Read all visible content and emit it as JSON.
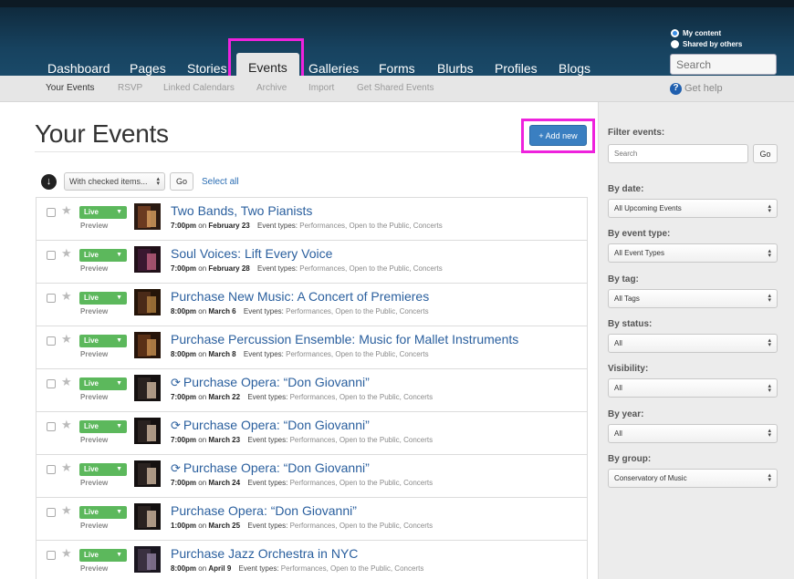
{
  "nav": {
    "items": [
      {
        "label": "Dashboard"
      },
      {
        "label": "Pages"
      },
      {
        "label": "Stories"
      },
      {
        "label": "Events"
      },
      {
        "label": "Galleries"
      },
      {
        "label": "Forms"
      },
      {
        "label": "Blurbs"
      },
      {
        "label": "Profiles"
      },
      {
        "label": "Blogs"
      }
    ],
    "active": "Events"
  },
  "visibility": {
    "my_content": "My content",
    "shared": "Shared by others"
  },
  "search": {
    "placeholder": "Search"
  },
  "subnav": {
    "items": [
      {
        "label": "Your Events"
      },
      {
        "label": "RSVP"
      },
      {
        "label": "Linked Calendars"
      },
      {
        "label": "Archive"
      },
      {
        "label": "Import"
      },
      {
        "label": "Get Shared Events"
      }
    ],
    "help": "Get help"
  },
  "main": {
    "title": "Your Events",
    "add_new": "+ Add new",
    "bulk_action": "With checked items...",
    "go": "Go",
    "select_all": "Select all"
  },
  "events": [
    {
      "status": "Live",
      "preview": "Preview",
      "title": "Two Bands, Two Pianists",
      "time": "7:00pm",
      "date": "February 23",
      "recurring": false,
      "types_label": "Event types:",
      "types": "Performances, Open to the Public, Concerts"
    },
    {
      "status": "Live",
      "preview": "Preview",
      "title": "Soul Voices: Lift Every Voice",
      "time": "7:00pm",
      "date": "February 28",
      "recurring": false,
      "types_label": "Event types:",
      "types": "Performances, Open to the Public, Concerts"
    },
    {
      "status": "Live",
      "preview": "Preview",
      "title": "Purchase New Music: A Concert of Premieres",
      "time": "8:00pm",
      "date": "March 6",
      "recurring": false,
      "types_label": "Event types:",
      "types": "Performances, Open to the Public, Concerts"
    },
    {
      "status": "Live",
      "preview": "Preview",
      "title": "Purchase Percussion Ensemble: Music for Mallet Instruments",
      "time": "8:00pm",
      "date": "March 8",
      "recurring": false,
      "types_label": "Event types:",
      "types": "Performances, Open to the Public, Concerts"
    },
    {
      "status": "Live",
      "preview": "Preview",
      "title": "Purchase Opera: “Don Giovanni”",
      "time": "7:00pm",
      "date": "March 22",
      "recurring": true,
      "types_label": "Event types:",
      "types": "Performances, Open to the Public, Concerts"
    },
    {
      "status": "Live",
      "preview": "Preview",
      "title": "Purchase Opera: “Don Giovanni”",
      "time": "7:00pm",
      "date": "March 23",
      "recurring": true,
      "types_label": "Event types:",
      "types": "Performances, Open to the Public, Concerts"
    },
    {
      "status": "Live",
      "preview": "Preview",
      "title": "Purchase Opera: “Don Giovanni”",
      "time": "7:00pm",
      "date": "March 24",
      "recurring": true,
      "types_label": "Event types:",
      "types": "Performances, Open to the Public, Concerts"
    },
    {
      "status": "Live",
      "preview": "Preview",
      "title": "Purchase Opera: “Don Giovanni”",
      "time": "1:00pm",
      "date": "March 25",
      "recurring": false,
      "types_label": "Event types:",
      "types": "Performances, Open to the Public, Concerts"
    },
    {
      "status": "Live",
      "preview": "Preview",
      "title": "Purchase Jazz Orchestra in NYC",
      "time": "8:00pm",
      "date": "April 9",
      "recurring": false,
      "types_label": "Event types:",
      "types": "Performances, Open to the Public, Concerts"
    }
  ],
  "on_word": "on",
  "sidebar": {
    "filter_label": "Filter events:",
    "filter_placeholder": "Search",
    "go": "Go",
    "filters": [
      {
        "label": "By date:",
        "value": "All Upcoming Events"
      },
      {
        "label": "By event type:",
        "value": "All Event Types"
      },
      {
        "label": "By tag:",
        "value": "All Tags"
      },
      {
        "label": "By status:",
        "value": "All"
      },
      {
        "label": "Visibility:",
        "value": "All"
      },
      {
        "label": "By year:",
        "value": "All"
      },
      {
        "label": "By group:",
        "value": "Conservatory of Music"
      }
    ]
  },
  "colors": {
    "accent": "#3a7fc1",
    "live": "#5cb85c",
    "highlight": "#ee22dd",
    "link": "#2a5f9e"
  }
}
